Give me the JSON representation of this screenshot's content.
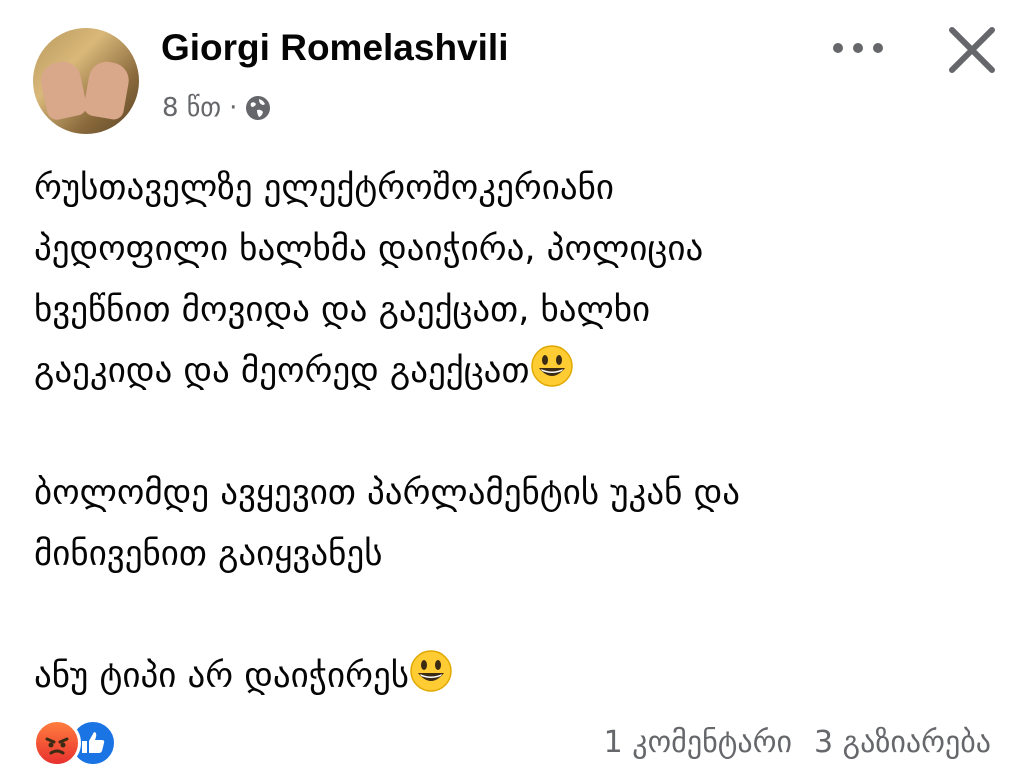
{
  "post": {
    "author_name": "Giorgi Romelashvili",
    "time": "8 წთ",
    "separator": "·",
    "audience_icon": "globe-icon",
    "paragraphs": [
      {
        "lines": [
          "რუსთაველზე ელექტროშოკერიანი",
          "პედოფილი ხალხმა დაიჭირა, პოლიცია",
          "ხვეწნით მოვიდა და გაექცათ, ხალხი",
          "გაეკიდა და მეორედ გაექცათ"
        ]
      },
      {
        "lines": [
          "ბოლომდე ავყევით პარლამენტის უკან და",
          "მინივენით გაიყვანეს"
        ]
      },
      {
        "lines": [
          "ანუ ტიპი არ დაიჭირეს"
        ]
      }
    ],
    "emoji": "grinning-face"
  },
  "footer": {
    "reactions": [
      "angry-reaction-icon",
      "like-reaction-icon"
    ],
    "comments": "1 კომენტარი",
    "shares": "3 გაზიარება"
  },
  "colors": {
    "text": "#050505",
    "secondary_text": "#65676b",
    "like_blue": "#1b74e4",
    "angry_red": "#e8312f"
  }
}
